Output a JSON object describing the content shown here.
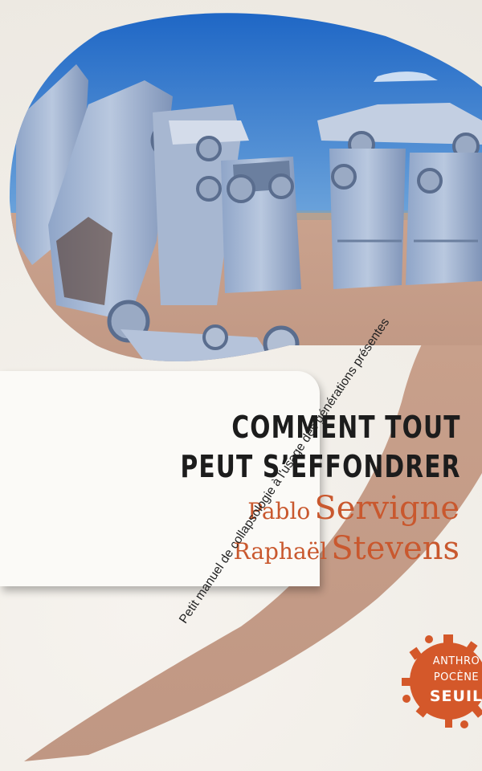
{
  "book": {
    "title_line1": "COMMENT TOUT",
    "title_line2": "PEUT S’EFFONDRER",
    "authors": [
      {
        "first": "Pablo",
        "last": "Servigne"
      },
      {
        "first": "Raphaël",
        "last": "Stevens"
      }
    ],
    "subtitle": "Petit manuel de collapsologie à l'usage des générations présentes",
    "collection": {
      "line1": "ANTHRO",
      "line2": "POCÈNE",
      "publisher": "SEUIL"
    }
  },
  "colors": {
    "accent": "#c9582e",
    "background": "#efece6",
    "road": "#c7a18c"
  },
  "photo": {
    "subject": "cars-planted-nose-down-in-desert"
  }
}
